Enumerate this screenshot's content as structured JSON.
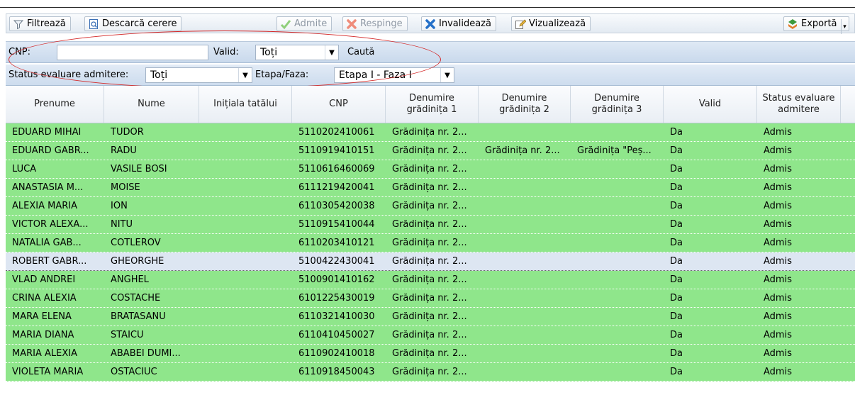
{
  "toolbar": {
    "filter_label": "Filtrează",
    "download_label": "Descarcă cerere",
    "admit_label": "Admite",
    "reject_label": "Respinge",
    "invalidate_label": "Invalidează",
    "view_label": "Vizualizează",
    "export_label": "Exportă"
  },
  "filters": {
    "cnp_label": "CNP:",
    "cnp_value": "",
    "valid_label": "Valid:",
    "valid_value": "Toți",
    "search_label": "Caută",
    "status_label": "Status evaluare admitere:",
    "status_value": "Toți",
    "stage_label": "Etapa/Faza:",
    "stage_value": "Etapa I - Faza I"
  },
  "table": {
    "columns": [
      "Prenume",
      "Nume",
      "Inițiala tatălui",
      "CNP",
      "Denumire grădinița 1",
      "Denumire grădinița 2",
      "Denumire grădinița 3",
      "Valid",
      "Status evaluare admitere"
    ],
    "rows": [
      [
        "EDUARD MIHAI",
        "TUDOR",
        "",
        "5110202410061",
        "Grădinița nr. 2...",
        "",
        "",
        "Da",
        "Admis"
      ],
      [
        "EDUARD GABR...",
        "RADU",
        "",
        "5110919410151",
        "Grădinița nr. 2...",
        "Grădinița nr. 2...",
        "Grădinița \"Peș...",
        "Da",
        "Admis"
      ],
      [
        "LUCA",
        "VASILE BOSI",
        "",
        "5110616460069",
        "Grădinița nr. 2...",
        "",
        "",
        "Da",
        "Admis"
      ],
      [
        "ANASTASIA M...",
        "MOISE",
        "",
        "6111219420041",
        "Grădinița nr. 2...",
        "",
        "",
        "Da",
        "Admis"
      ],
      [
        "ALEXIA MARIA",
        "ION",
        "",
        "6110305420038",
        "Grădinița nr. 2...",
        "",
        "",
        "Da",
        "Admis"
      ],
      [
        "VICTOR ALEXA...",
        "NITU",
        "",
        "5110915410044",
        "Grădinița nr. 2...",
        "",
        "",
        "Da",
        "Admis"
      ],
      [
        "NATALIA GAB...",
        "COTLEROV",
        "",
        "6110203410121",
        "Grădinița nr. 2...",
        "",
        "",
        "Da",
        "Admis"
      ],
      [
        "ROBERT GABR...",
        "GHEORGHE",
        "",
        "5100422430041",
        "Grădinița nr. 2...",
        "",
        "",
        "Da",
        "Admis"
      ],
      [
        "VLAD ANDREI",
        "ANGHEL",
        "",
        "5100901410162",
        "Grădinița nr. 2...",
        "",
        "",
        "Da",
        "Admis"
      ],
      [
        "CRINA ALEXIA",
        "COSTACHE",
        "",
        "6101225430019",
        "Grădinița nr. 2...",
        "",
        "",
        "Da",
        "Admis"
      ],
      [
        "MARA ELENA",
        "BRATASANU",
        "",
        "6110321410030",
        "Grădinița nr. 2...",
        "",
        "",
        "Da",
        "Admis"
      ],
      [
        "MARIA DIANA",
        "STAICU",
        "",
        "6110410450027",
        "Grădinița nr. 2...",
        "",
        "",
        "Da",
        "Admis"
      ],
      [
        "MARIA ALEXIA",
        "ABABEI DUMI...",
        "",
        "6110902410018",
        "Grădinița nr. 2...",
        "",
        "",
        "Da",
        "Admis"
      ],
      [
        "VIOLETA MARIA",
        "OSTACIUC",
        "",
        "6110918450043",
        "Grădinița nr. 2...",
        "",
        "",
        "Da",
        "Admis"
      ]
    ],
    "selected_row": 7
  },
  "colors": {
    "row_admitted": "#8fe68b",
    "row_selected": "#dde6f2",
    "annotation": "#d42a2a"
  }
}
